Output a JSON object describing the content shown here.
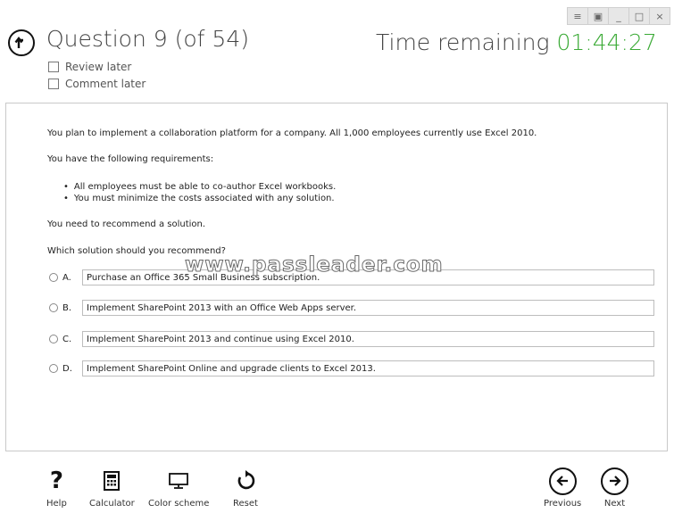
{
  "window_controls": {
    "menu_icon": "menu-icon",
    "snap_icon": "snap-icon",
    "minimize_symbol": "_",
    "maximize_symbol": "□",
    "close_symbol": "×"
  },
  "header": {
    "question_title": "Question 9 (of 54)",
    "review_later_label": "Review later",
    "comment_later_label": "Comment later",
    "time_remaining_label": "Time remaining",
    "time_value": "01:44:27",
    "time_color": "#3aaa35"
  },
  "question": {
    "intro": "You plan to implement a collaboration platform for a company. All 1,000 employees currently use Excel 2010.",
    "requirements_heading": "You have the following requirements:",
    "requirements": [
      "All employees must be able to co-author Excel workbooks.",
      "You must minimize the costs associated with any solution."
    ],
    "need": "You need to recommend a solution.",
    "prompt": "Which solution should you recommend?",
    "watermark": "www.passleader.com",
    "options": [
      {
        "letter": "A.",
        "text": "Purchase an Office 365 Small Business subscription."
      },
      {
        "letter": "B.",
        "text": "Implement SharePoint 2013 with an Office Web Apps server."
      },
      {
        "letter": "C.",
        "text": "Implement SharePoint 2013 and continue using Excel 2010."
      },
      {
        "letter": "D.",
        "text": "Implement SharePoint Online and upgrade clients to Excel 2013."
      }
    ]
  },
  "toolbar": {
    "help_label": "Help",
    "calculator_label": "Calculator",
    "color_scheme_label": "Color scheme",
    "reset_label": "Reset",
    "previous_label": "Previous",
    "next_label": "Next"
  }
}
